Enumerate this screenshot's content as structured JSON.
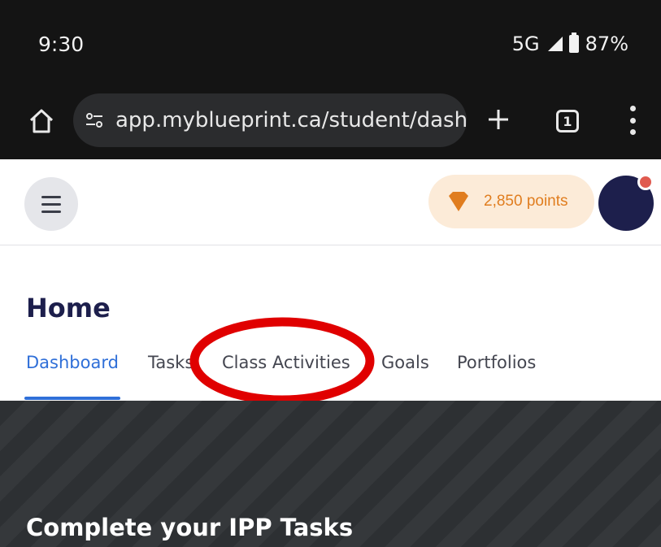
{
  "status_bar": {
    "time": "9:30",
    "network": "5G",
    "battery": "87%",
    "icons": [
      "signal-icon",
      "battery-icon"
    ]
  },
  "browser": {
    "url": "app.myblueprint.ca/student/dashb",
    "tab_count": "1",
    "icons": [
      "home-icon",
      "tune-icon",
      "plus-icon",
      "tabs-icon",
      "more-vert-icon"
    ]
  },
  "header": {
    "points": "2,850 points",
    "icons": [
      "menu-icon",
      "gem-icon",
      "avatar"
    ],
    "colors": {
      "points_text": "#e07d1f",
      "points_bg": "#fcebd8",
      "avatar": "#1d1f4c",
      "notification": "#e05a4f"
    }
  },
  "page": {
    "title": "Home",
    "tabs": [
      {
        "label": "Dashboard",
        "active": true
      },
      {
        "label": "Tasks"
      },
      {
        "label": "Class Activities"
      },
      {
        "label": "Goals"
      },
      {
        "label": "Portfolios"
      }
    ]
  },
  "banner": {
    "title": "Complete your IPP Tasks"
  },
  "colors": {
    "accent": "#2f6fd8",
    "title": "#1d1f4c",
    "annotation": "#e00000"
  }
}
